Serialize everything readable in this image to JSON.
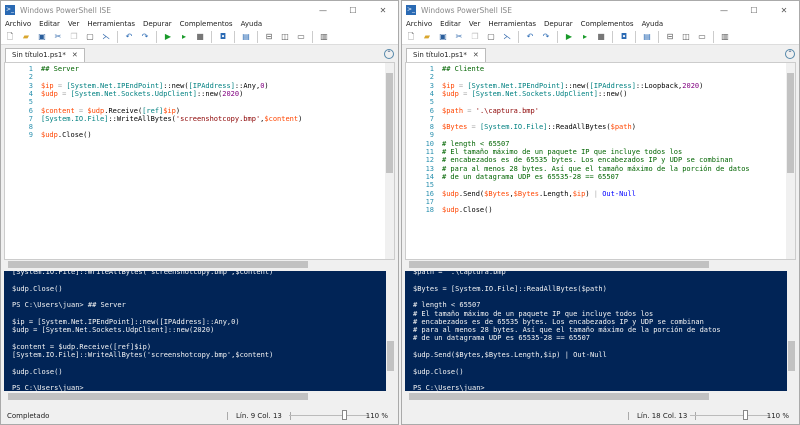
{
  "colors": {
    "console_bg": "#012456",
    "variable": "#ff4500",
    "type": "#008080",
    "string": "#8b0000",
    "number": "#800080",
    "comment": "#006400",
    "command": "#0000ff"
  },
  "windows": [
    {
      "title": "Windows PowerShell ISE",
      "menu": [
        "Archivo",
        "Editar",
        "Ver",
        "Herramientas",
        "Depurar",
        "Complementos",
        "Ayuda"
      ],
      "tab": "Sin título1.ps1*",
      "code": [
        [
          [
            "## Server",
            "cmt"
          ]
        ],
        [],
        [
          [
            "$ip",
            "var"
          ],
          [
            " = ",
            "op"
          ],
          [
            "[System.Net.IPEndPoint]",
            "type"
          ],
          [
            "::new(",
            "mem"
          ],
          [
            "[IPAddress]",
            "type"
          ],
          [
            "::Any,",
            "mem"
          ],
          [
            "0",
            "num"
          ],
          [
            ")",
            "mem"
          ]
        ],
        [
          [
            "$udp",
            "var"
          ],
          [
            " = ",
            "op"
          ],
          [
            "[System.Net.Sockets.UdpClient]",
            "type"
          ],
          [
            "::new(",
            "mem"
          ],
          [
            "2020",
            "num"
          ],
          [
            ")",
            "mem"
          ]
        ],
        [],
        [
          [
            "$content",
            "var"
          ],
          [
            " = ",
            "op"
          ],
          [
            "$udp",
            "var"
          ],
          [
            ".Receive(",
            "mem"
          ],
          [
            "[ref]",
            "type"
          ],
          [
            "$ip",
            "var"
          ],
          [
            ")",
            "mem"
          ]
        ],
        [
          [
            "[System.IO.File]",
            "type"
          ],
          [
            "::WriteAllBytes(",
            "mem"
          ],
          [
            "'screenshotcopy.bmp'",
            "str"
          ],
          [
            ",",
            "mem"
          ],
          [
            "$content",
            "var"
          ],
          [
            ")",
            "mem"
          ]
        ],
        [],
        [
          [
            "$udp",
            "var"
          ],
          [
            ".Close()",
            "mem"
          ]
        ]
      ],
      "console": [
        "[System.IO.File]::WriteAllBytes('screenshotcopy.bmp',$content)",
        "",
        "$udp.Close()",
        "",
        "PS C:\\Users\\juan> ## Server",
        "",
        "$ip = [System.Net.IPEndPoint]::new([IPAddress]::Any,0)",
        "$udp = [System.Net.Sockets.UdpClient]::new(2020)",
        "",
        "$content = $udp.Receive([ref]$ip)",
        "[System.IO.File]::WriteAllBytes('screenshotcopy.bmp',$content)",
        "",
        "$udp.Close()",
        "",
        "PS C:\\Users\\juan>"
      ],
      "status": "Completado",
      "position": "Lín. 9  Col. 13",
      "zoom": "110 %",
      "zoom_value": 110
    },
    {
      "title": "Windows PowerShell ISE",
      "menu": [
        "Archivo",
        "Editar",
        "Ver",
        "Herramientas",
        "Depurar",
        "Complementos",
        "Ayuda"
      ],
      "tab": "Sin título1.ps1*",
      "code": [
        [
          [
            "## Cliente",
            "cmt"
          ]
        ],
        [],
        [
          [
            "$ip",
            "var"
          ],
          [
            " = ",
            "op"
          ],
          [
            "[System.Net.IPEndPoint]",
            "type"
          ],
          [
            "::new(",
            "mem"
          ],
          [
            "[IPAddress]",
            "type"
          ],
          [
            "::Loopback,",
            "mem"
          ],
          [
            "2020",
            "num"
          ],
          [
            ")",
            "mem"
          ]
        ],
        [
          [
            "$udp",
            "var"
          ],
          [
            " = ",
            "op"
          ],
          [
            "[System.Net.Sockets.UdpClient]",
            "type"
          ],
          [
            "::new()",
            "mem"
          ]
        ],
        [],
        [
          [
            "$path",
            "var"
          ],
          [
            " = ",
            "op"
          ],
          [
            "'.\\captura.bmp'",
            "str"
          ]
        ],
        [],
        [
          [
            "$Bytes",
            "var"
          ],
          [
            " = ",
            "op"
          ],
          [
            "[System.IO.File]",
            "type"
          ],
          [
            "::ReadAllBytes(",
            "mem"
          ],
          [
            "$path",
            "var"
          ],
          [
            ")",
            "mem"
          ]
        ],
        [],
        [
          [
            "# length < 65507",
            "cmt"
          ]
        ],
        [
          [
            "# El tamaño máximo de un paquete IP que incluye todos los",
            "cmt"
          ]
        ],
        [
          [
            "# encabezados es de 65535 bytes. Los encabezados IP y UDP se combinan",
            "cmt"
          ]
        ],
        [
          [
            "# para al menos 28 bytes. Así que el tamaño máximo de la porción de datos",
            "cmt"
          ]
        ],
        [
          [
            "# de un datagrama UDP es 65535-28 == 65507",
            "cmt"
          ]
        ],
        [],
        [
          [
            "$udp",
            "var"
          ],
          [
            ".Send(",
            "mem"
          ],
          [
            "$Bytes",
            "var"
          ],
          [
            ",",
            "mem"
          ],
          [
            "$Bytes",
            "var"
          ],
          [
            ".Length,",
            "mem"
          ],
          [
            "$ip",
            "var"
          ],
          [
            ")",
            "mem"
          ],
          [
            " | ",
            "op"
          ],
          [
            "Out-Null",
            "cmd"
          ]
        ],
        [],
        [
          [
            "$udp",
            "var"
          ],
          [
            ".Close()",
            "mem"
          ]
        ]
      ],
      "console": [
        "$path = '.\\captura.bmp'",
        "",
        "$Bytes = [System.IO.File]::ReadAllBytes($path)",
        "",
        "# length < 65507",
        "# El tamaño máximo de un paquete IP que incluye todos los",
        "# encabezados es de 65535 bytes. Los encabezados IP y UDP se combinan",
        "# para al menos 28 bytes. Así que el tamaño máximo de la porción de datos",
        "# de un datagrama UDP es 65535-28 == 65507",
        "",
        "$udp.Send($Bytes,$Bytes.Length,$ip) | Out-Null",
        "",
        "$udp.Close()",
        "",
        "PS C:\\Users\\juan>"
      ],
      "status": "",
      "position": "Lín. 18  Col. 13",
      "zoom": "110 %",
      "zoom_value": 110
    }
  ]
}
